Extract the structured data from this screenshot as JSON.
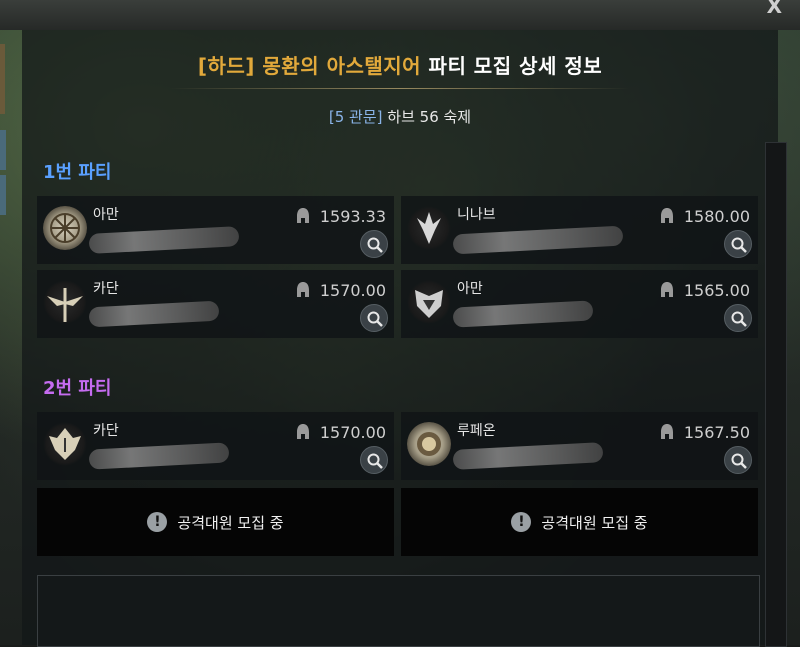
{
  "window": {
    "close_label": "X"
  },
  "header": {
    "title_highlight": "[하드] 몽환의 아스탤지어",
    "title_rest": "파티 모집 상세 정보",
    "subtitle_highlight": "[5 관문]",
    "subtitle_rest": "하브 56 숙제"
  },
  "parties": [
    {
      "label": "1번 파티",
      "label_color": "#5aa0ff",
      "members": [
        {
          "class": "아만",
          "item_level": "1593.33",
          "emblem_icon": "aman-emblem-icon"
        },
        {
          "class": "니나브",
          "item_level": "1580.00",
          "emblem_icon": "ninav-emblem-icon"
        },
        {
          "class": "카단",
          "item_level": "1570.00",
          "emblem_icon": "kadan-emblem-icon"
        },
        {
          "class": "아만",
          "item_level": "1565.00",
          "emblem_icon": "aman-emblem-icon"
        }
      ]
    },
    {
      "label": "2번 파티",
      "label_color": "#c56cf0",
      "members": [
        {
          "class": "카단",
          "item_level": "1570.00",
          "emblem_icon": "kadan-emblem-icon"
        },
        {
          "class": "루페온",
          "item_level": "1567.50",
          "emblem_icon": "rufeon-emblem-icon"
        }
      ],
      "recruiting": [
        {
          "label": "공격대원 모집 중"
        },
        {
          "label": "공격대원 모집 중"
        }
      ]
    }
  ],
  "colors": {
    "accent_gold": "#e2a93b",
    "accent_blue": "#8ab4e8"
  }
}
